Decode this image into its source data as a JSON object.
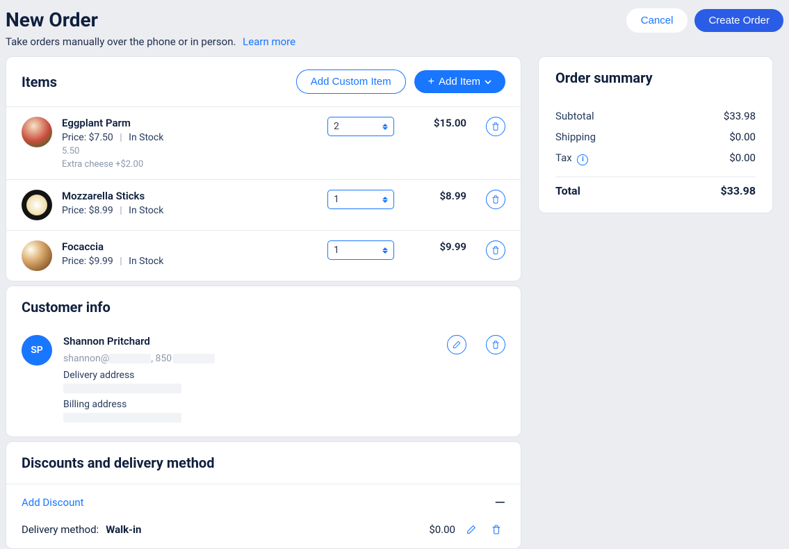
{
  "header": {
    "title": "New Order",
    "subtitle": "Take orders manually over the phone or in person.",
    "learn_more": "Learn more",
    "cancel": "Cancel",
    "create_order": "Create Order"
  },
  "items_card": {
    "title": "Items",
    "add_custom": "Add Custom Item",
    "add_item": "Add Item",
    "items": [
      {
        "name": "Eggplant Parm",
        "price_label": "Price: $7.50",
        "stock_label": "In Stock",
        "note1": "5.50",
        "note2": "Extra cheese +$2.00",
        "qty": "2",
        "line_total": "$15.00"
      },
      {
        "name": "Mozzarella Sticks",
        "price_label": "Price: $8.99",
        "stock_label": "In Stock",
        "qty": "1",
        "line_total": "$8.99"
      },
      {
        "name": "Focaccia",
        "price_label": "Price: $9.99",
        "stock_label": "In Stock",
        "qty": "1",
        "line_total": "$9.99"
      }
    ]
  },
  "customer_card": {
    "title": "Customer info",
    "initials": "SP",
    "name": "Shannon Pritchard",
    "email_prefix": "shannon@",
    "phone_prefix": ", 850",
    "delivery_label": "Delivery address",
    "billing_label": "Billing address"
  },
  "discounts_card": {
    "title": "Discounts and delivery method",
    "add_discount": "Add Discount",
    "delivery_label": "Delivery method:",
    "delivery_value": "Walk-in",
    "delivery_price": "$0.00"
  },
  "summary": {
    "title": "Order summary",
    "subtotal_label": "Subtotal",
    "subtotal_value": "$33.98",
    "shipping_label": "Shipping",
    "shipping_value": "$0.00",
    "tax_label": "Tax",
    "tax_value": "$0.00",
    "total_label": "Total",
    "total_value": "$33.98"
  }
}
